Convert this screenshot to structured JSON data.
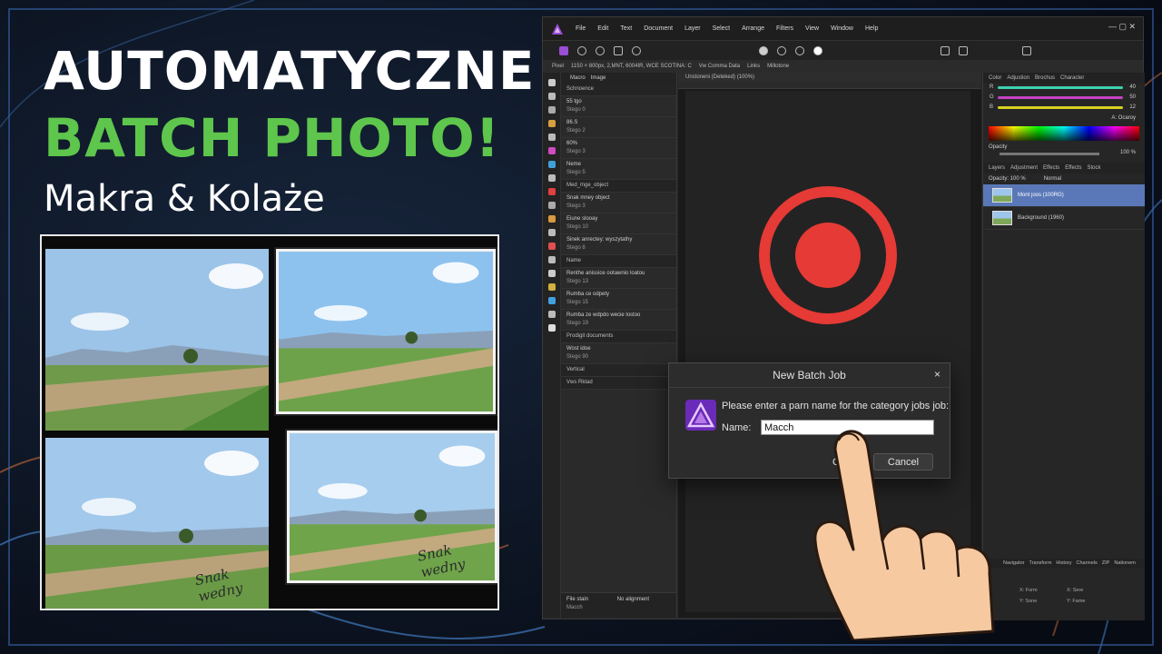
{
  "headline": {
    "line1": "AUTOMATYCZNE",
    "line2": "BATCH PHOTO!",
    "line3": "Makra & Kolaże"
  },
  "collage": {
    "signature1": "Snak wedny",
    "signature2": "Snak wedny"
  },
  "app": {
    "menu": [
      "File",
      "Edit",
      "Text",
      "Document",
      "Layer",
      "Select",
      "Arrange",
      "Filters",
      "View",
      "Window",
      "Help"
    ],
    "context_bar": {
      "label": "Pixel",
      "info": "1150 × 800px, 2,MNT, 6004IR, WCE SCOTINA: C",
      "view": "Vw Comma Data",
      "links": "Links",
      "mode": "Millotone"
    },
    "canvas_tab": "Unstoneni (Deteked) (100%)",
    "macro_panel": {
      "tabs": [
        "Macro",
        "Image"
      ],
      "rows": [
        {
          "type": "header",
          "text": "Schnoence"
        },
        {
          "type": "item",
          "text": "55 tgo",
          "sub": "Stego 0"
        },
        {
          "type": "item",
          "text": "86.S",
          "sub": "Stego 2"
        },
        {
          "type": "item",
          "text": "60%",
          "sub": "Stego 3"
        },
        {
          "type": "item",
          "text": "Neme",
          "sub": "Stego 5"
        },
        {
          "type": "header",
          "text": "Med_mge_object"
        },
        {
          "type": "item",
          "text": "Snak mney object",
          "sub": "Stego 3"
        },
        {
          "type": "item",
          "text": "Eiune slooay",
          "sub": "Stego 10"
        },
        {
          "type": "item",
          "text": "Sinek anrectey: wyszytathy",
          "sub": "Stego 8"
        },
        {
          "type": "header",
          "text": "Name"
        },
        {
          "type": "item",
          "text": "Renthe anissice ootawnio loatou",
          "sub": "Stego 13"
        },
        {
          "type": "item",
          "text": "Rumba ce odpety",
          "sub": "Stego 15"
        },
        {
          "type": "item",
          "text": "Rumba ze wdpdo wecie lostoo",
          "sub": "Stego 19"
        },
        {
          "type": "header",
          "text": "Prodigit documents"
        },
        {
          "type": "item",
          "text": "Wost idoe",
          "sub": "Stego 90"
        },
        {
          "type": "header",
          "text": "Vertical"
        },
        {
          "type": "header",
          "text": "Vws Rktad"
        }
      ],
      "footer_left": "File stain",
      "footer_right": "No alignment",
      "search": "Macch"
    },
    "right_panel": {
      "tabs1": [
        "Color",
        "Adjustion",
        "Brochus",
        "Character"
      ],
      "sliders": [
        {
          "label": "R",
          "value": "40",
          "color": "#3bd0b0"
        },
        {
          "label": "G",
          "value": "50",
          "color": "#c442c4"
        },
        {
          "label": "B",
          "value": "12",
          "color": "#d8d020"
        }
      ],
      "picker": "A: Ocaroy",
      "opacity_label": "Opacity",
      "opacity_value": "100 %",
      "tabs2": [
        "Layers",
        "Adjustment",
        "Effects",
        "Effects",
        "Stock"
      ],
      "layer_opacity": "Opacity: 100 %",
      "blend": "Normal",
      "layers": [
        {
          "name": "Mont joos (100RG)",
          "selected": true
        },
        {
          "name": "Background (1960)",
          "selected": false
        }
      ],
      "nav_tabs": [
        "Navigator",
        "Transform",
        "History",
        "Channels",
        "ZIP",
        "Nationem"
      ],
      "fields": [
        "X: Form",
        "X: Sere",
        "Y: Sone",
        "Y: Fame"
      ]
    },
    "dialog": {
      "title": "New Batch Job",
      "close": "×",
      "prompt": "Please enter a parn name for the category jobs job:",
      "name_label": "Name:",
      "name_value": "Macch",
      "ok": "OK",
      "cancel": "Cancel"
    }
  },
  "colors": {
    "accent_green": "#5ec64c",
    "record_red": "#e53a35",
    "selection_blue": "#5a78b8",
    "app_logo": "#9a4dd6"
  }
}
